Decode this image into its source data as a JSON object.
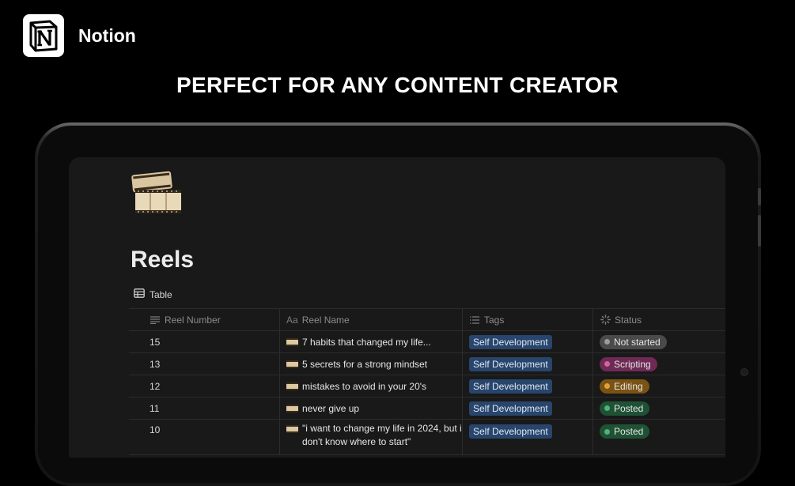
{
  "brand": {
    "name": "Notion",
    "logo_icon": "notion-logo-icon"
  },
  "headline": "PERFECT FOR ANY CONTENT CREATOR",
  "page": {
    "icon": "film-reel-icon",
    "title": "Reels",
    "view_label": "Table",
    "view_icon": "table-icon"
  },
  "table": {
    "columns": [
      {
        "label": "Reel Number",
        "icon": "text-lines-icon"
      },
      {
        "label": "Reel Name",
        "icon": "title-aa-icon"
      },
      {
        "label": "Tags",
        "icon": "multi-select-icon"
      },
      {
        "label": "Status",
        "icon": "status-spinner-icon"
      }
    ],
    "rows": [
      {
        "number": "15",
        "name": "7 habits that changed my life...",
        "tag": "Self Development",
        "status": "Not started"
      },
      {
        "number": "13",
        "name": "5 secrets for a strong mindset",
        "tag": "Self Development",
        "status": "Scripting"
      },
      {
        "number": "12",
        "name": "mistakes to avoid in your 20's",
        "tag": "Self Development",
        "status": "Editing"
      },
      {
        "number": "11",
        "name": "never give up",
        "tag": "Self Development",
        "status": "Posted"
      },
      {
        "number": "10",
        "name": "\"i want to change my life in 2024, but i don't know where to start\"",
        "tag": "Self Development",
        "status": "Posted"
      }
    ]
  },
  "colors": {
    "background": "#000000",
    "screen": "#191919",
    "tag_blue": "#28456c",
    "status_not_started": "#4a4a4a",
    "status_scripting": "#6e2a55",
    "status_editing": "#7a5314",
    "status_posted": "#1f5234"
  }
}
